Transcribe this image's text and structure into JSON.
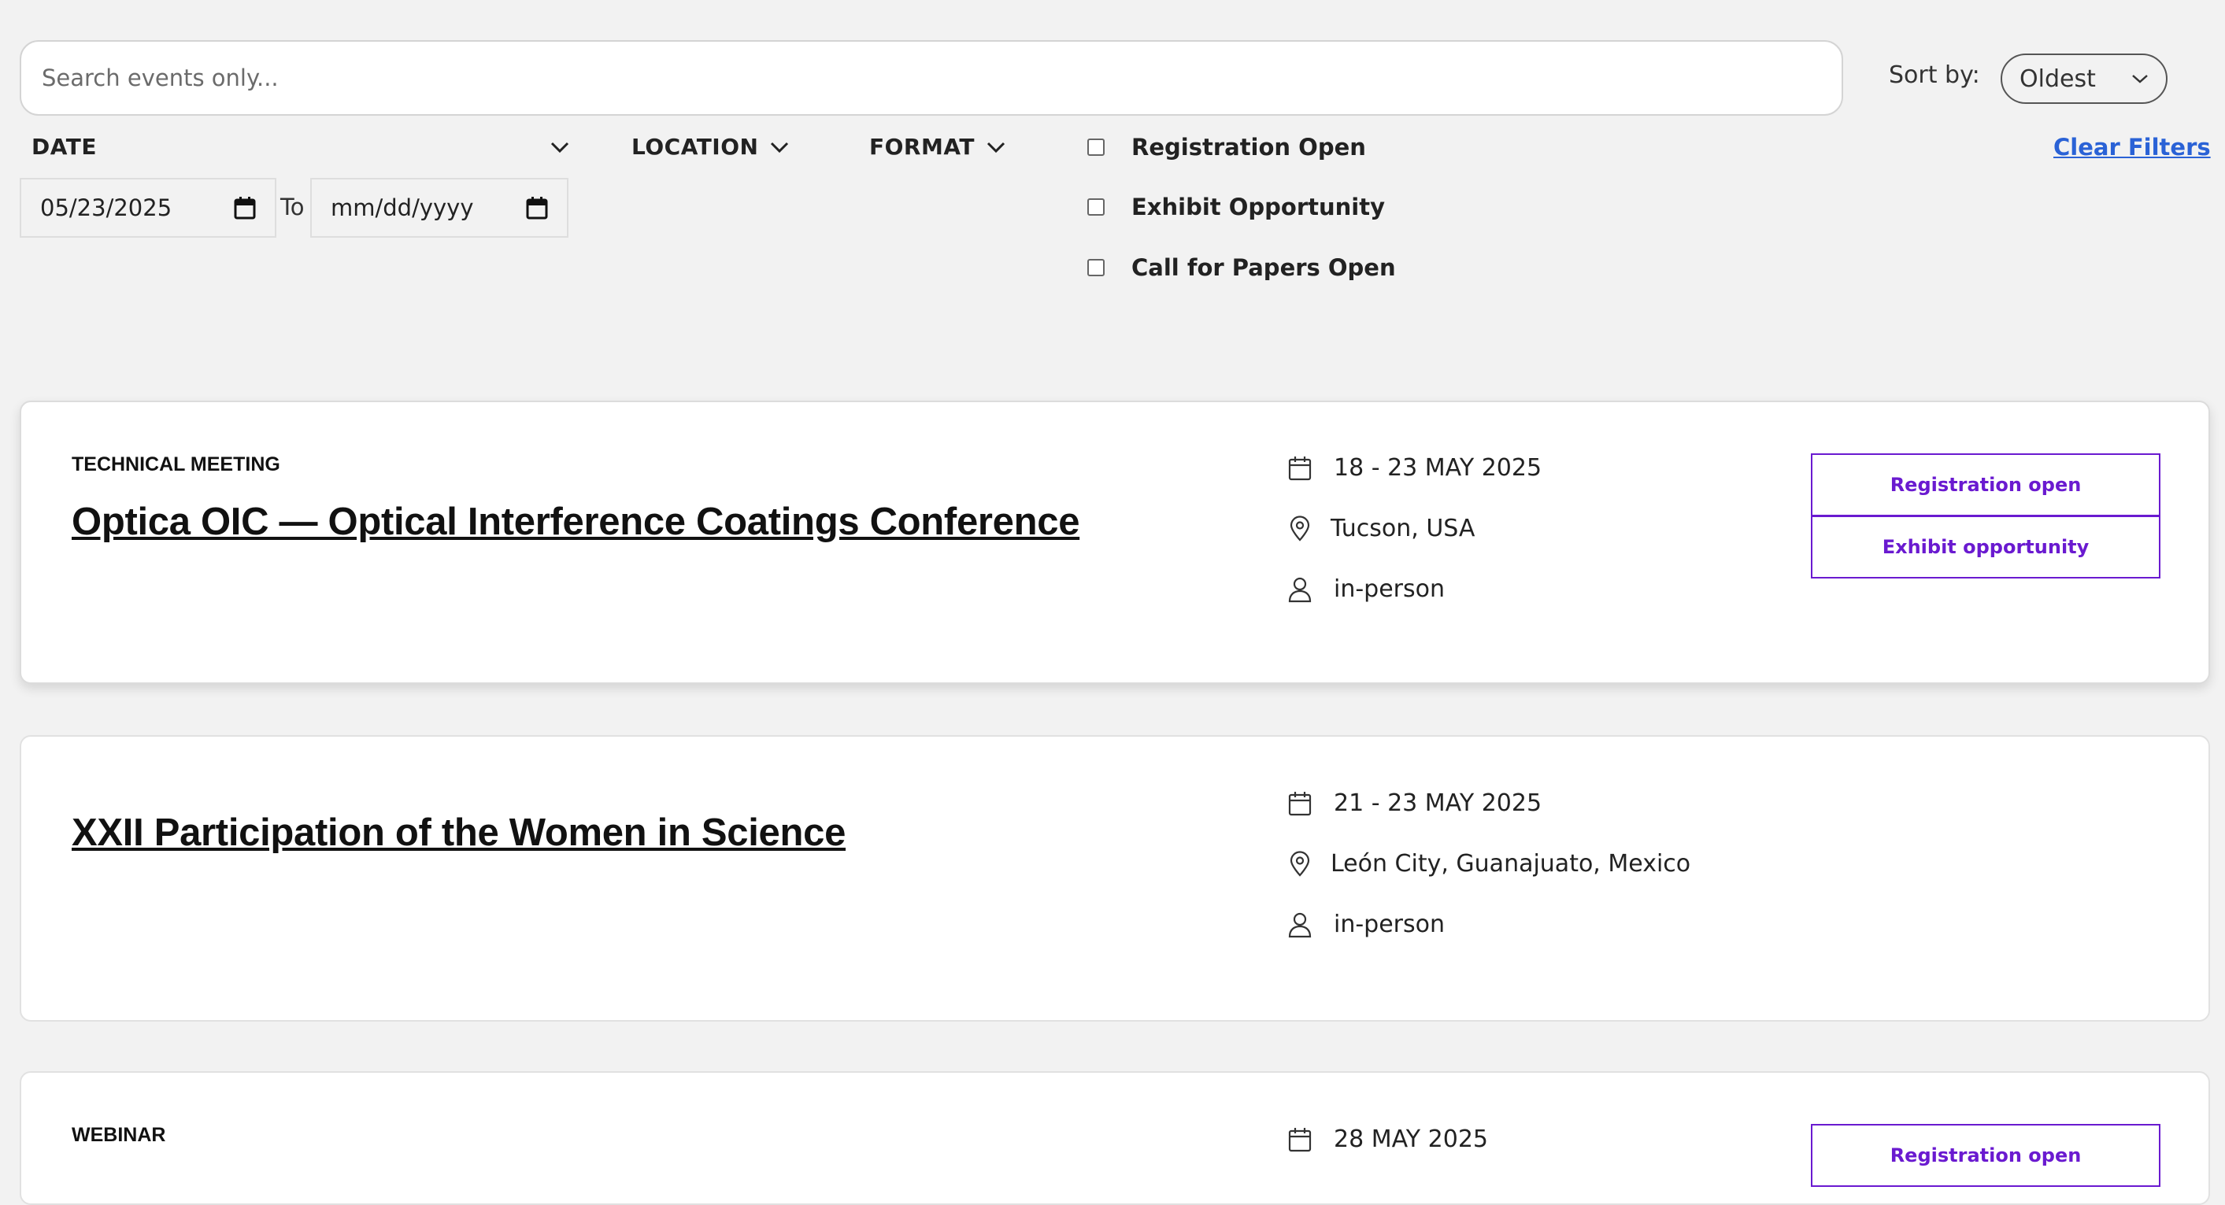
{
  "search": {
    "placeholder": "Search events only..."
  },
  "sort": {
    "label": "Sort by:",
    "selected": "Oldest"
  },
  "filters": {
    "date_label": "DATE",
    "location_label": "LOCATION",
    "format_label": "FORMAT",
    "date_from": "05/23/2025",
    "to_label": "To",
    "date_to_placeholder": "mm/dd/yyyy",
    "checkboxes": [
      {
        "label": "Registration Open",
        "checked": false
      },
      {
        "label": "Exhibit Opportunity",
        "checked": false
      },
      {
        "label": "Call for Papers Open",
        "checked": false
      }
    ],
    "clear_label": "Clear Filters"
  },
  "events": [
    {
      "type": "TECHNICAL MEETING",
      "title": "Optica OIC — Optical Interference Coatings Conference",
      "date": "18 - 23 MAY 2025",
      "location": "Tucson, USA",
      "format": "in-person",
      "badges": [
        "Registration open",
        "Exhibit opportunity"
      ]
    },
    {
      "type": "",
      "title": "XXII Participation of the Women in Science",
      "date": "21 - 23 MAY 2025",
      "location": "León City, Guanajuato, Mexico",
      "format": "in-person",
      "badges": []
    },
    {
      "type": "WEBINAR",
      "title": "",
      "date": "28 MAY 2025",
      "location": "",
      "format": "",
      "badges": [
        "Registration open"
      ]
    }
  ],
  "colors": {
    "badge": "#6a1ad0",
    "link": "#2a62d6",
    "background": "#f2f2f2"
  },
  "icons": [
    "chevron-down-icon",
    "calendar-icon",
    "location-pin-icon",
    "person-icon"
  ]
}
